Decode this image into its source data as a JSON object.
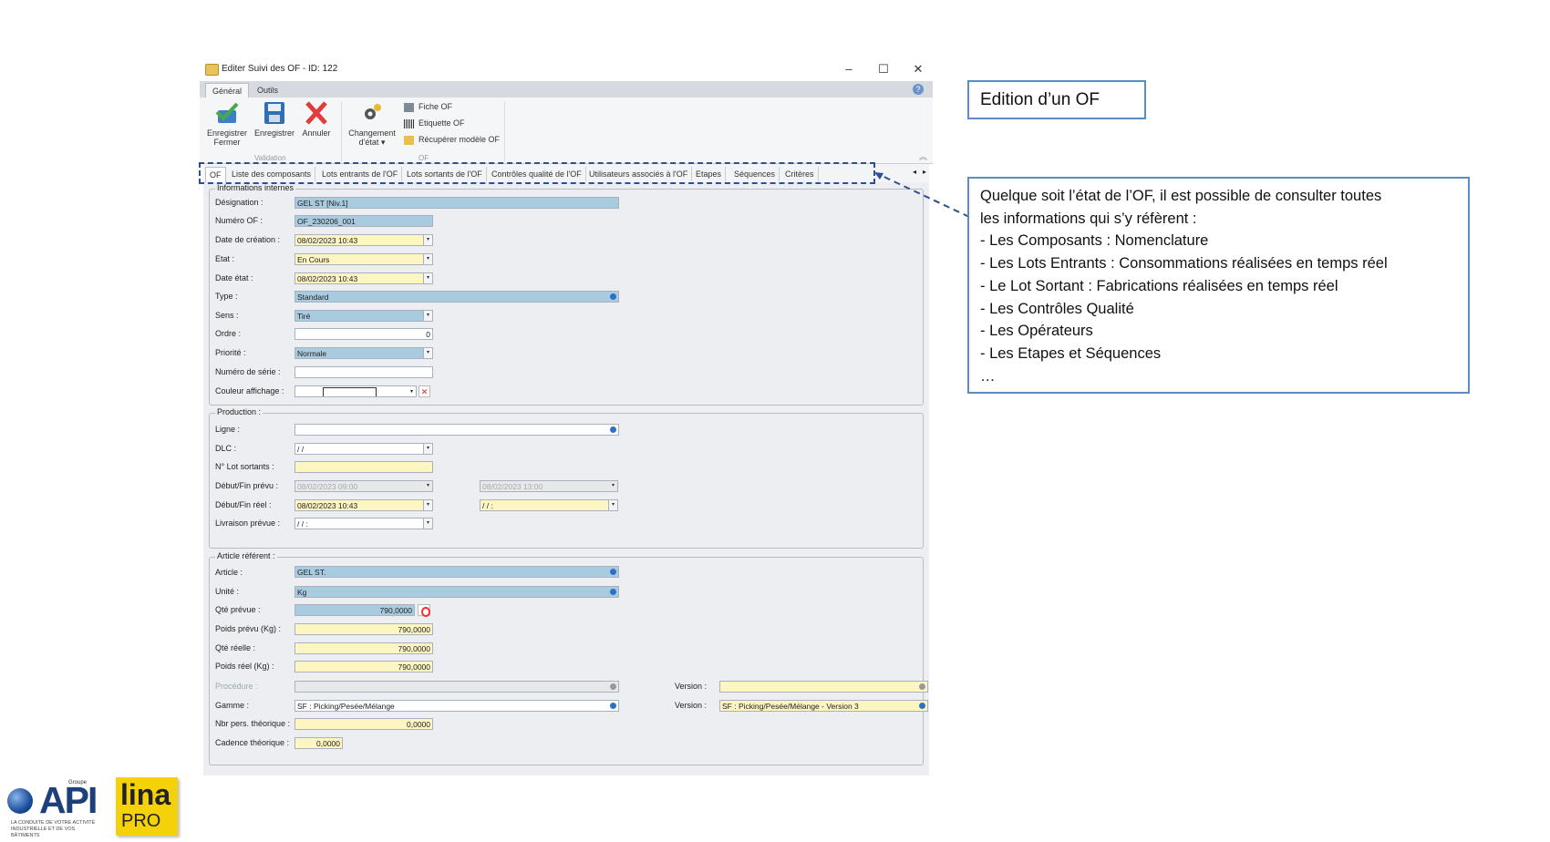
{
  "window": {
    "title": "Editer Suivi des OF - ID: 122"
  },
  "ribbon_tabs": [
    "Général",
    "Outils"
  ],
  "ribbon": {
    "buttons": [
      "Enregistrer Fermer",
      "Enregistrer",
      "Annuler",
      "Changement d'état"
    ],
    "btn_lines": [
      [
        "Enregistrer",
        "Fermer"
      ],
      [
        "Enregistrer"
      ],
      [
        "Annuler"
      ],
      [
        "Changement",
        "d'état ▾"
      ]
    ],
    "small_buttons": [
      "Fiche OF",
      "Etiquette OF",
      "Récupérer modèle OF"
    ],
    "group_validation": "Validation",
    "group_of": "OF"
  },
  "doc_tabs": [
    "OF",
    "Liste des composants",
    "Lots entrants de l'OF",
    "Lots sortants de l'OF",
    "Contrôles qualité de l'OF",
    "Utilisateurs associés à l'OF",
    "Etapes",
    "Séquences",
    "Critères"
  ],
  "infos": {
    "group_title": "Informations internes",
    "designation_label": "Désignation :",
    "designation": "GEL ST [Niv.1]",
    "numero_label": "Numéro OF :",
    "numero": "OF_230206_001",
    "date_creation_label": "Date de création :",
    "date_creation": "08/02/2023 10:43",
    "etat_label": "Etat :",
    "etat": "En Cours",
    "date_etat_label": "Date état :",
    "date_etat": "08/02/2023 10:43",
    "type_label": "Type :",
    "type": "Standard",
    "sens_label": "Sens :",
    "sens": "Tiré",
    "ordre_label": "Ordre :",
    "ordre": "0",
    "priorite_label": "Priorité :",
    "priorite": "Normale",
    "serie_label": "Numéro de série :",
    "serie": "",
    "couleur_label": "Couleur affichage :"
  },
  "production": {
    "group_title": "Production :",
    "ligne_label": "Ligne :",
    "ligne": "",
    "dlc_label": "DLC :",
    "dlc": "  /   /",
    "lot_label": "N° Lot sortants :",
    "lot": "",
    "debut_fin_prevu_label": "Début/Fin prévu :",
    "debut_prevu": "08/02/2023 09:00",
    "fin_prevu": "08/02/2023 13:00",
    "debut_fin_reel_label": "Début/Fin réel :",
    "debut_reel": "08/02/2023 10:43",
    "fin_reel": "  /   /          :",
    "livraison_label": "Livraison prévue :",
    "livraison": "  /   /          :"
  },
  "article": {
    "group_title": "Article référent :",
    "article_label": "Article :",
    "article": "GEL ST.",
    "unite_label": "Unité :",
    "unite": "Kg",
    "qte_prevue_label": "Qté prévue :",
    "qte_prevue": "790,0000",
    "poids_prevu_label": "Poids prévu (Kg) :",
    "poids_prevu": "790,0000",
    "qte_reelle_label": "Qté réelle :",
    "qte_reelle": "790,0000",
    "poids_reel_label": "Poids réel (Kg) :",
    "poids_reel": "790,0000",
    "procedure_label": "Procédure :",
    "procedure": "",
    "version_label": "Version :",
    "version1": "",
    "gamme_label": "Gamme :",
    "gamme": "SF : Picking/Pesée/Mélange",
    "version2": "SF : Picking/Pesée/Mélange - Version 3",
    "nbr_pers_label": "Nbr pers. théorique :",
    "nbr_pers": "0,0000",
    "cadence_label": "Cadence théorique :",
    "cadence": "0,0000"
  },
  "annotations": {
    "title": "Edition d’un OF",
    "lines": [
      "Quelque soit l’état de l’OF, il est possible de consulter toutes",
      "les informations qui s’y réfèrent :",
      "- Les Composants : Nomenclature",
      "- Les Lots Entrants : Consommations réalisées en temps réel",
      "- Le Lot Sortant : Fabrications réalisées en temps réel",
      "- Les Contrôles Qualité",
      "- Les Opérateurs",
      "- Les Etapes et Séquences",
      "…"
    ]
  },
  "logos": {
    "api": "API",
    "api_small": "Groupe",
    "api_tagline": "LA CONDUITE DE VOTRE ACTIVITÉ INDUSTRIELLE ET DE VOS BÂTIMENTS",
    "lina": "lina",
    "pro": "PRO"
  },
  "colors": {
    "accent": "#5b8cc4",
    "field_blue": "#a9cbe0",
    "field_yellow": "#fdf6c3",
    "lina_yellow": "#f5d10a"
  }
}
